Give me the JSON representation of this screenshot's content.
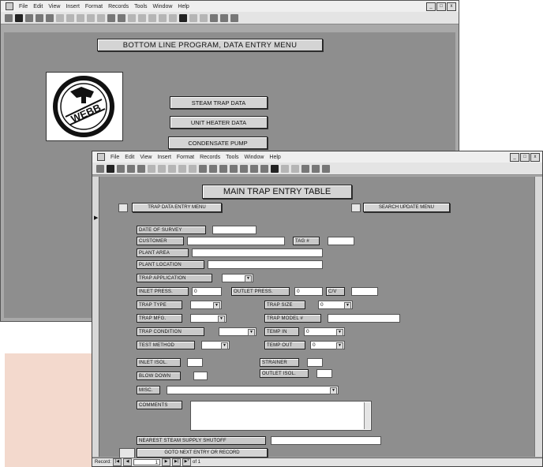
{
  "menu_items": [
    "File",
    "Edit",
    "View",
    "Insert",
    "Format",
    "Records",
    "Tools",
    "Window",
    "Help"
  ],
  "window_controls": [
    "_",
    "□",
    "x"
  ],
  "back_window": {
    "title_button": "BOTTOM LINE PROGRAM, DATA ENTRY MENU",
    "logo_text": "WEBB",
    "buttons": [
      "STEAM TRAP DATA",
      "UNIT HEATER DATA",
      "CONDENSATE PUMP"
    ]
  },
  "front_window": {
    "title": "MAIN TRAP ENTRY TABLE",
    "left_nav_button": "TRAP DATA ENTRY MENU",
    "right_nav_button": "SEARCH UPDATE MENU",
    "labels": {
      "date_of_survey": "DATE OF SURVEY",
      "customer": "CUSTOMER",
      "tag_no": "TAG #",
      "plant_area": "PLANT AREA",
      "plant_location": "PLANT LOCATION",
      "trap_application": "TRAP APPLICATION",
      "inlet_press": "INLET PRESS.",
      "outlet_press": "OUTLET PRESS.",
      "cv": "C/V",
      "trap_type": "TRAP TYPE",
      "trap_size": "TRAP SIZE",
      "trap_mfg": "TRAP MFG.",
      "trap_model": "TRAP MODEL #",
      "trap_condition": "TRAP CONDITION",
      "temp_in": "TEMP IN",
      "test_method": "TEST METHOD",
      "temp_out": "TEMP OUT",
      "inlet_isol": "INLET ISOL.",
      "strainer": "STRAINER",
      "blow_down": "BLOW DOWN",
      "outlet_isol": "OUTLET ISOL.",
      "misc": "MISC.",
      "comments": "COMMENTS",
      "nearest_shutoff": "NEAREST STEAM SUPPLY SHUTOFF"
    },
    "values": {
      "inlet_press": "0",
      "outlet_press": "0",
      "trap_size": "0",
      "temp_in": "0",
      "temp_out": "0"
    },
    "bottom_button": "GOTO NEXT ENTRY OR RECORD",
    "record_nav": {
      "label": "Record:",
      "current": "1",
      "of_text": "of 1"
    }
  },
  "colors": {
    "window_bg": "#8e8e8e",
    "button_face": "#d4d4d4",
    "peach_panel": "#f3d9cd"
  }
}
